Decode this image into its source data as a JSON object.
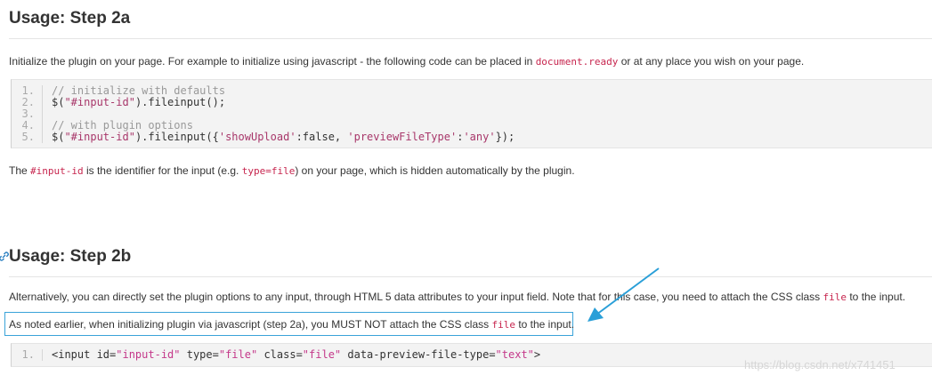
{
  "step2a": {
    "heading": "Usage: Step 2a",
    "intro_before": "Initialize the plugin on your page. For example to initialize using javascript - the following code can be placed in ",
    "intro_code": "document.ready",
    "intro_after": " or at any place you wish on your page.",
    "code_lines": [
      {
        "num": "1.",
        "parts": [
          {
            "t": "// initialize with defaults",
            "c": "cm"
          }
        ]
      },
      {
        "num": "2.",
        "parts": [
          {
            "t": "$(",
            "c": ""
          },
          {
            "t": "\"#input-id\"",
            "c": "str"
          },
          {
            "t": ").fileinput();",
            "c": ""
          }
        ]
      },
      {
        "num": "3.",
        "parts": [
          {
            "t": "",
            "c": ""
          }
        ]
      },
      {
        "num": "4.",
        "parts": [
          {
            "t": "// with plugin options",
            "c": "cm"
          }
        ]
      },
      {
        "num": "5.",
        "parts": [
          {
            "t": "$(",
            "c": ""
          },
          {
            "t": "\"#input-id\"",
            "c": "str"
          },
          {
            "t": ").fileinput({",
            "c": ""
          },
          {
            "t": "'showUpload'",
            "c": "str"
          },
          {
            "t": ":",
            "c": ""
          },
          {
            "t": "false",
            "c": "kw"
          },
          {
            "t": ", ",
            "c": ""
          },
          {
            "t": "'previewFileType'",
            "c": "str"
          },
          {
            "t": ":",
            "c": ""
          },
          {
            "t": "'any'",
            "c": "str"
          },
          {
            "t": "});",
            "c": ""
          }
        ]
      }
    ],
    "after_before": "The ",
    "after_code1": "#input-id",
    "after_mid": " is the identifier for the input (e.g. ",
    "after_code2": "type=file",
    "after_end": ") on your page, which is hidden automatically by the plugin."
  },
  "step2b": {
    "heading": "Usage: Step 2b",
    "alt_before": "Alternatively, you can directly set the plugin options to any input, through HTML 5 data attributes to your input field. Note that for this case, you need to attach the CSS class ",
    "alt_code": "file",
    "alt_after": " to the input.",
    "note_before": "As noted earlier, when initializing plugin via javascript (step 2a), you MUST NOT attach the CSS class ",
    "note_code": "file",
    "note_after": " to the input.",
    "code_lines": [
      {
        "num": "1.",
        "parts": [
          {
            "t": "<input id=",
            "c": ""
          },
          {
            "t": "\"input-id\"",
            "c": "str2"
          },
          {
            "t": " type=",
            "c": ""
          },
          {
            "t": "\"file\"",
            "c": "str2"
          },
          {
            "t": " class=",
            "c": ""
          },
          {
            "t": "\"file\"",
            "c": "str2"
          },
          {
            "t": " data-preview-file-type=",
            "c": ""
          },
          {
            "t": "\"text\"",
            "c": "str2"
          },
          {
            "t": ">",
            "c": ""
          }
        ]
      }
    ]
  },
  "watermark": "https://blog.csdn.net/x741451",
  "colors": {
    "inline_code": "#c7254e",
    "note_border": "#3aa3d9",
    "arrow": "#2a9fd8"
  },
  "icons": [
    "link-icon",
    "arrow-annotation"
  ]
}
